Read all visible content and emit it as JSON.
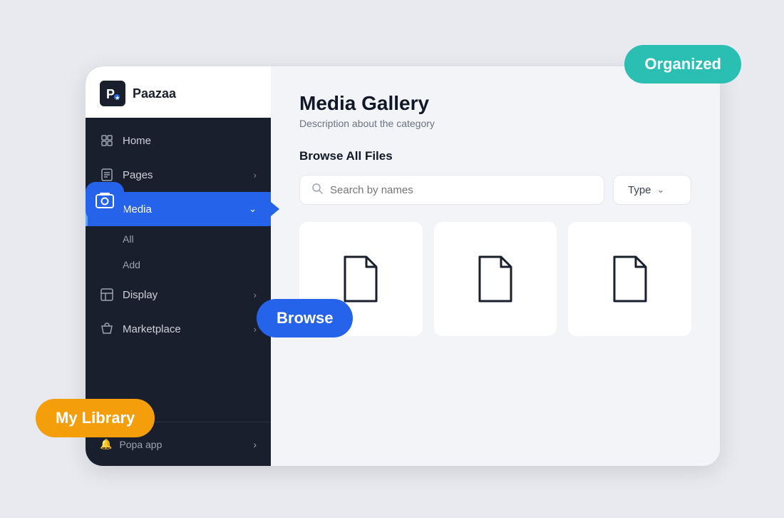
{
  "app": {
    "logo_letter": "P",
    "name": "Paazaa"
  },
  "sidebar": {
    "nav_items": [
      {
        "id": "home",
        "label": "Home",
        "icon": "home",
        "has_chevron": false,
        "active": false
      },
      {
        "id": "pages",
        "label": "Pages",
        "icon": "pages",
        "has_chevron": true,
        "active": false
      },
      {
        "id": "media",
        "label": "Media",
        "icon": "media",
        "has_chevron": true,
        "active": true
      },
      {
        "id": "display",
        "label": "Display",
        "icon": "display",
        "has_chevron": true,
        "active": false
      },
      {
        "id": "marketplace",
        "label": "Marketplace",
        "icon": "marketplace",
        "has_chevron": true,
        "active": false
      }
    ],
    "media_sub_items": [
      "All",
      "Add"
    ],
    "footer": {
      "app_name": "Popa app"
    }
  },
  "content": {
    "title": "Media Gallery",
    "description": "Description about the category",
    "section_label": "Browse All Files",
    "search_placeholder": "Search by names",
    "type_dropdown_label": "Type",
    "files": [
      {
        "id": "file1"
      },
      {
        "id": "file2"
      },
      {
        "id": "file3"
      }
    ]
  },
  "badges": {
    "organized": "Organized",
    "browse": "Browse",
    "my_library": "My Library"
  },
  "colors": {
    "teal": "#2bbfb3",
    "blue": "#2563eb",
    "amber": "#f59e0b",
    "sidebar_bg": "#1a1f2e"
  }
}
